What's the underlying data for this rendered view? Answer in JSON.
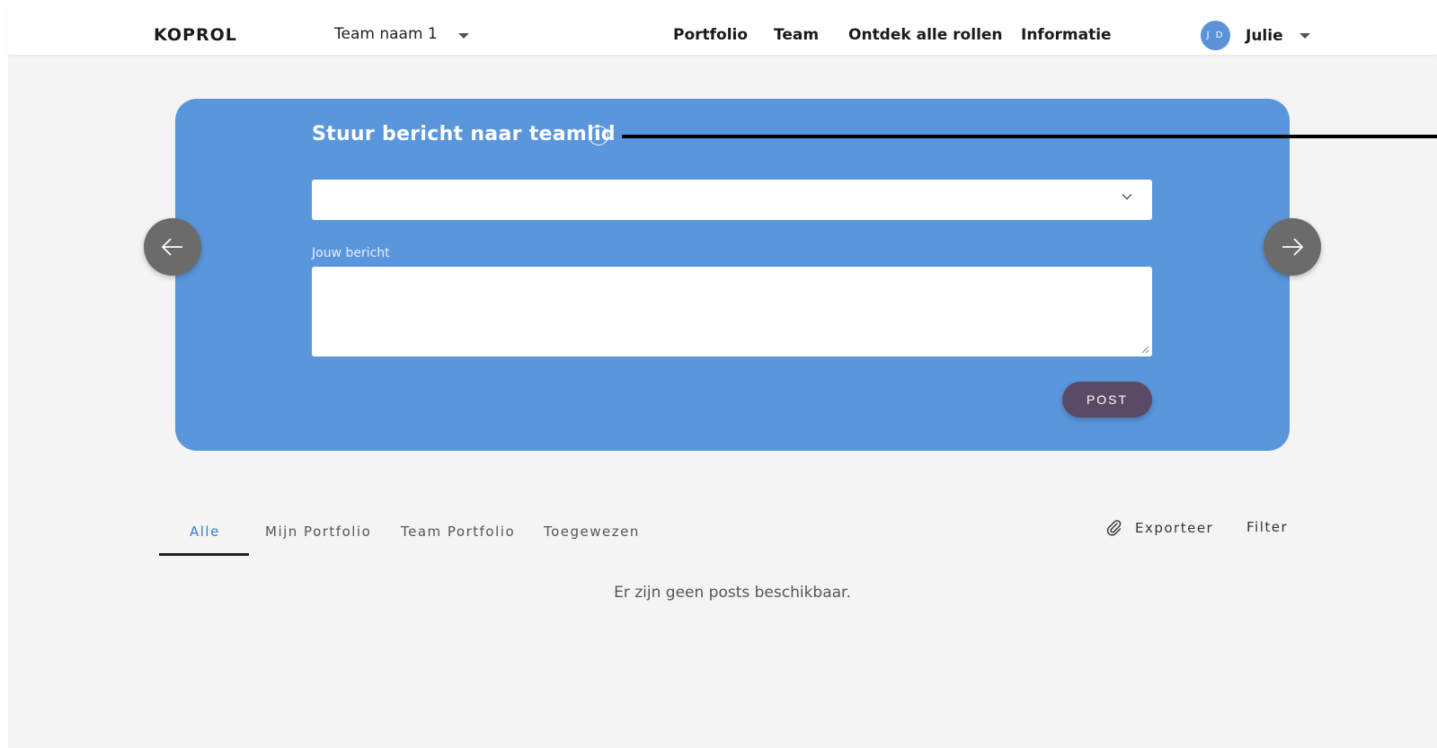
{
  "header": {
    "logo": "KOPROL",
    "team_select": "Team naam 1",
    "nav": [
      "Portfolio",
      "Team",
      "Ontdek alle rollen",
      "Informatie"
    ],
    "user": {
      "initials": "J D",
      "name": "Julie"
    }
  },
  "card": {
    "title": "Stuur bericht naar teamlid",
    "info_icon": "info-icon",
    "member_select_value": "",
    "message_label": "Jouw bericht",
    "message_value": "",
    "post_label": "POST",
    "background_color": "#5a96dc",
    "post_color": "#5a4a66"
  },
  "tabs": {
    "items": [
      "Alle",
      "Mijn Portfolio",
      "Team Portfolio",
      "Toegewezen"
    ],
    "active": "Alle",
    "export_label": "Exporteer",
    "export_icon": "paperclip-icon",
    "filter_label": "Filter"
  },
  "empty_message": "Er zijn geen posts beschikbaar.",
  "colors": {
    "accent": "#3a7bd5",
    "avatar": "#5a93dc",
    "arrow_button": "#6b6b6b"
  }
}
